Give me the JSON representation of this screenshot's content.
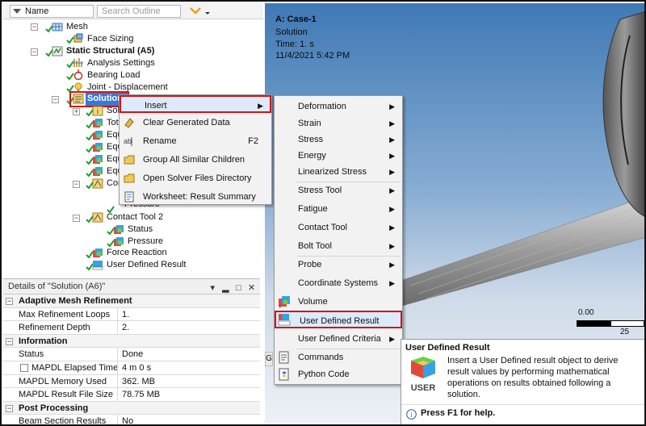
{
  "tree": {
    "header": {
      "name_label": "Name",
      "search_placeholder": "Search Outline"
    },
    "nodes": [
      {
        "label": "Mesh"
      },
      {
        "label": "Face Sizing"
      },
      {
        "label": "Static Structural (A5)"
      },
      {
        "label": "Analysis Settings"
      },
      {
        "label": "Bearing Load"
      },
      {
        "label": "Joint - Displacement"
      },
      {
        "label": "Solution (A6)"
      },
      {
        "label": "Solu"
      },
      {
        "label": "Tot"
      },
      {
        "label": "Equ"
      },
      {
        "label": "Equ"
      },
      {
        "label": "Equ"
      },
      {
        "label": "Equ"
      },
      {
        "label": "Con"
      },
      {
        "label": "Pressure"
      },
      {
        "label": "Contact Tool 2"
      },
      {
        "label": "Status"
      },
      {
        "label": "Pressure"
      },
      {
        "label": "Force Reaction"
      },
      {
        "label": "User Defined Result"
      }
    ]
  },
  "details": {
    "title": "Details of \"Solution (A6)\"",
    "buttons": {
      "pin": "▾",
      "autohide": "▂",
      "float": "□",
      "close": "✕"
    },
    "sections": [
      {
        "name": "Adaptive Mesh Refinement",
        "rows": [
          {
            "label": "Max Refinement Loops",
            "value": "1."
          },
          {
            "label": "Refinement Depth",
            "value": "2."
          }
        ]
      },
      {
        "name": "Information",
        "rows": [
          {
            "label": "Status",
            "value": "Done"
          },
          {
            "label": "MAPDL Elapsed Time",
            "value": "4 m 0 s"
          },
          {
            "label": "MAPDL Memory Used",
            "value": "362. MB"
          },
          {
            "label": "MAPDL Result File Size",
            "value": "78.75 MB"
          }
        ]
      },
      {
        "name": "Post Processing",
        "rows": [
          {
            "label": "Beam Section Results",
            "value": "No"
          }
        ]
      }
    ]
  },
  "graphics": {
    "case": "A: Case-1",
    "type": "Solution",
    "time": "Time: 1. s",
    "date": "11/4/2021 5:42 PM",
    "scale_start": "0.00",
    "scale_end": "25"
  },
  "context_menu": {
    "items": [
      {
        "label": "Insert",
        "shortcut": ""
      },
      {
        "label": "Clear Generated Data",
        "shortcut": ""
      },
      {
        "label": "Rename",
        "shortcut": "F2"
      },
      {
        "label": "Group All Similar Children",
        "shortcut": ""
      },
      {
        "label": "Open Solver Files Directory",
        "shortcut": ""
      },
      {
        "label": "Worksheet: Result Summary",
        "shortcut": ""
      }
    ]
  },
  "submenu": {
    "items": [
      {
        "label": "Deformation"
      },
      {
        "label": "Strain"
      },
      {
        "label": "Stress"
      },
      {
        "label": "Energy"
      },
      {
        "label": "Linearized Stress"
      },
      {
        "label": "Stress Tool"
      },
      {
        "label": "Fatigue"
      },
      {
        "label": "Contact Tool"
      },
      {
        "label": "Bolt Tool"
      },
      {
        "label": "Probe"
      },
      {
        "label": "Coordinate Systems"
      },
      {
        "label": "Volume"
      },
      {
        "label": "User Defined Result"
      },
      {
        "label": "User Defined Criteria"
      },
      {
        "label": "Commands"
      },
      {
        "label": "Python Code"
      }
    ]
  },
  "tooltip": {
    "title": "User Defined Result",
    "body": "Insert a User Defined result object to derive result values by performing mathematical operations on results obtained following a solution.",
    "icon_text": "USER",
    "help": "Press F1 for help."
  },
  "colors": {
    "highlight_border": "#d01515",
    "check": "#1f9e2e",
    "menu_bg": "#f2f2f2"
  },
  "hidden_tab_letter": "G"
}
